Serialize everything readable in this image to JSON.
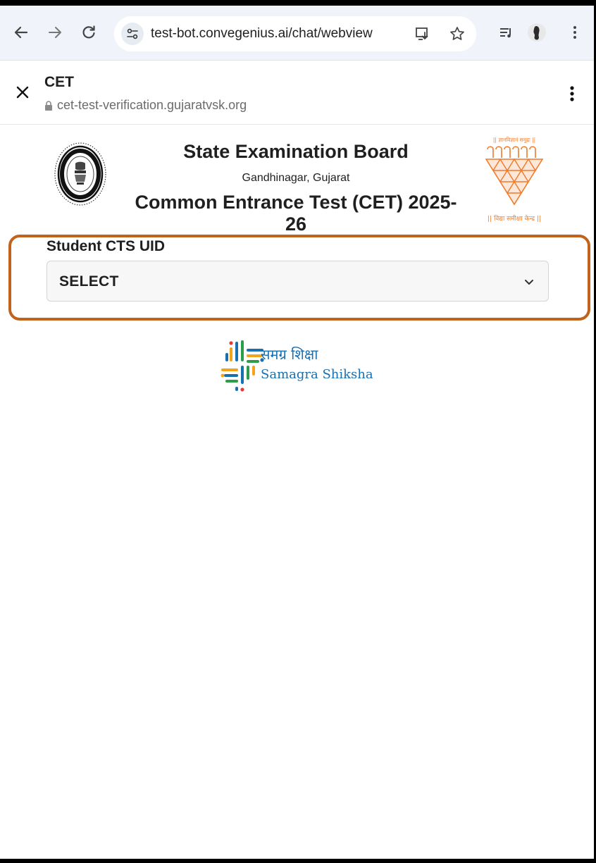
{
  "browser": {
    "url": "test-bot.convegenius.ai/chat/webview",
    "icons": [
      "back-arrow-icon",
      "forward-arrow-icon",
      "reload-icon",
      "site-settings-icon",
      "install-app-icon",
      "star-icon",
      "media-control-icon",
      "profile-avatar-icon",
      "kebab-menu-icon"
    ]
  },
  "custom_tab": {
    "title": "CET",
    "url": "cet-test-verification.gujaratvsk.org"
  },
  "page": {
    "board": "State Examination Board",
    "city": "Gandhinagar, Gujarat",
    "test": "Common Entrance Test (CET) 2025-26",
    "right_logo_top": "|| ज्ञानविज्ञानं समुद्रः ||",
    "right_logo_bottom": "|| विद्या समीक्षा केन्द्र ||"
  },
  "form": {
    "label": "Student CTS UID",
    "selected": "SELECT"
  },
  "footer_logo": {
    "hindi": "समग्र शिक्षा",
    "english": "Samagra Shiksha"
  },
  "colors": {
    "highlight": "#c0631c",
    "samagra_blue": "#1a6fb0",
    "vsk_orange": "#f07a2a"
  }
}
